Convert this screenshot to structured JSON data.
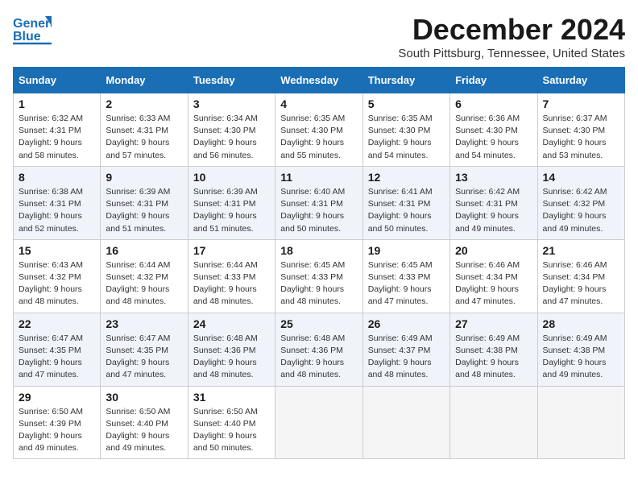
{
  "logo": {
    "line1": "General",
    "line2": "Blue"
  },
  "title": "December 2024",
  "location": "South Pittsburg, Tennessee, United States",
  "weekdays": [
    "Sunday",
    "Monday",
    "Tuesday",
    "Wednesday",
    "Thursday",
    "Friday",
    "Saturday"
  ],
  "weeks": [
    [
      {
        "day": 1,
        "sunrise": "6:32 AM",
        "sunset": "4:31 PM",
        "daylight": "9 hours and 58 minutes."
      },
      {
        "day": 2,
        "sunrise": "6:33 AM",
        "sunset": "4:31 PM",
        "daylight": "9 hours and 57 minutes."
      },
      {
        "day": 3,
        "sunrise": "6:34 AM",
        "sunset": "4:30 PM",
        "daylight": "9 hours and 56 minutes."
      },
      {
        "day": 4,
        "sunrise": "6:35 AM",
        "sunset": "4:30 PM",
        "daylight": "9 hours and 55 minutes."
      },
      {
        "day": 5,
        "sunrise": "6:35 AM",
        "sunset": "4:30 PM",
        "daylight": "9 hours and 54 minutes."
      },
      {
        "day": 6,
        "sunrise": "6:36 AM",
        "sunset": "4:30 PM",
        "daylight": "9 hours and 54 minutes."
      },
      {
        "day": 7,
        "sunrise": "6:37 AM",
        "sunset": "4:30 PM",
        "daylight": "9 hours and 53 minutes."
      }
    ],
    [
      {
        "day": 8,
        "sunrise": "6:38 AM",
        "sunset": "4:31 PM",
        "daylight": "9 hours and 52 minutes."
      },
      {
        "day": 9,
        "sunrise": "6:39 AM",
        "sunset": "4:31 PM",
        "daylight": "9 hours and 51 minutes."
      },
      {
        "day": 10,
        "sunrise": "6:39 AM",
        "sunset": "4:31 PM",
        "daylight": "9 hours and 51 minutes."
      },
      {
        "day": 11,
        "sunrise": "6:40 AM",
        "sunset": "4:31 PM",
        "daylight": "9 hours and 50 minutes."
      },
      {
        "day": 12,
        "sunrise": "6:41 AM",
        "sunset": "4:31 PM",
        "daylight": "9 hours and 50 minutes."
      },
      {
        "day": 13,
        "sunrise": "6:42 AM",
        "sunset": "4:31 PM",
        "daylight": "9 hours and 49 minutes."
      },
      {
        "day": 14,
        "sunrise": "6:42 AM",
        "sunset": "4:32 PM",
        "daylight": "9 hours and 49 minutes."
      }
    ],
    [
      {
        "day": 15,
        "sunrise": "6:43 AM",
        "sunset": "4:32 PM",
        "daylight": "9 hours and 48 minutes."
      },
      {
        "day": 16,
        "sunrise": "6:44 AM",
        "sunset": "4:32 PM",
        "daylight": "9 hours and 48 minutes."
      },
      {
        "day": 17,
        "sunrise": "6:44 AM",
        "sunset": "4:33 PM",
        "daylight": "9 hours and 48 minutes."
      },
      {
        "day": 18,
        "sunrise": "6:45 AM",
        "sunset": "4:33 PM",
        "daylight": "9 hours and 48 minutes."
      },
      {
        "day": 19,
        "sunrise": "6:45 AM",
        "sunset": "4:33 PM",
        "daylight": "9 hours and 47 minutes."
      },
      {
        "day": 20,
        "sunrise": "6:46 AM",
        "sunset": "4:34 PM",
        "daylight": "9 hours and 47 minutes."
      },
      {
        "day": 21,
        "sunrise": "6:46 AM",
        "sunset": "4:34 PM",
        "daylight": "9 hours and 47 minutes."
      }
    ],
    [
      {
        "day": 22,
        "sunrise": "6:47 AM",
        "sunset": "4:35 PM",
        "daylight": "9 hours and 47 minutes."
      },
      {
        "day": 23,
        "sunrise": "6:47 AM",
        "sunset": "4:35 PM",
        "daylight": "9 hours and 47 minutes."
      },
      {
        "day": 24,
        "sunrise": "6:48 AM",
        "sunset": "4:36 PM",
        "daylight": "9 hours and 48 minutes."
      },
      {
        "day": 25,
        "sunrise": "6:48 AM",
        "sunset": "4:36 PM",
        "daylight": "9 hours and 48 minutes."
      },
      {
        "day": 26,
        "sunrise": "6:49 AM",
        "sunset": "4:37 PM",
        "daylight": "9 hours and 48 minutes."
      },
      {
        "day": 27,
        "sunrise": "6:49 AM",
        "sunset": "4:38 PM",
        "daylight": "9 hours and 48 minutes."
      },
      {
        "day": 28,
        "sunrise": "6:49 AM",
        "sunset": "4:38 PM",
        "daylight": "9 hours and 49 minutes."
      }
    ],
    [
      {
        "day": 29,
        "sunrise": "6:50 AM",
        "sunset": "4:39 PM",
        "daylight": "9 hours and 49 minutes."
      },
      {
        "day": 30,
        "sunrise": "6:50 AM",
        "sunset": "4:40 PM",
        "daylight": "9 hours and 49 minutes."
      },
      {
        "day": 31,
        "sunrise": "6:50 AM",
        "sunset": "4:40 PM",
        "daylight": "9 hours and 50 minutes."
      },
      null,
      null,
      null,
      null
    ]
  ]
}
